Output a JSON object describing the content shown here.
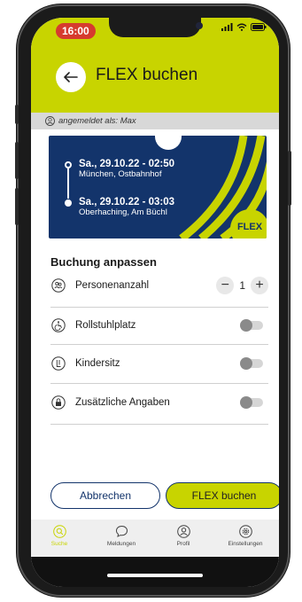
{
  "status": {
    "time": "16:00"
  },
  "header": {
    "title": "FLEX buchen"
  },
  "logged_in": {
    "text": "angemeldet als: Max"
  },
  "trip": {
    "departure": {
      "time": "Sa., 29.10.22 - 02:50",
      "place": "München, Ostbahnhof"
    },
    "arrival": {
      "time": "Sa., 29.10.22 - 03:03",
      "place": "Oberhaching, Am Büchl"
    },
    "badge": "FLEX"
  },
  "booking": {
    "section_title": "Buchung anpassen",
    "persons_label": "Personenanzahl",
    "persons_value": "1",
    "wheelchair_label": "Rollstuhlplatz",
    "child_seat_label": "Kindersitz",
    "extra_label": "Zusätzliche Angaben"
  },
  "buttons": {
    "cancel": "Abbrechen",
    "book": "FLEX buchen"
  },
  "tabs": [
    {
      "label": "Suche",
      "icon": "search-icon",
      "active": true
    },
    {
      "label": "Meldungen",
      "icon": "chat-bubble-icon",
      "active": false
    },
    {
      "label": "Profil",
      "icon": "profile-icon",
      "active": false
    },
    {
      "label": "Einstellungen",
      "icon": "gear-icon",
      "active": false
    }
  ],
  "colors": {
    "accent": "#c8d400",
    "navy": "#13346b",
    "time_pill": "#d63b2e"
  }
}
